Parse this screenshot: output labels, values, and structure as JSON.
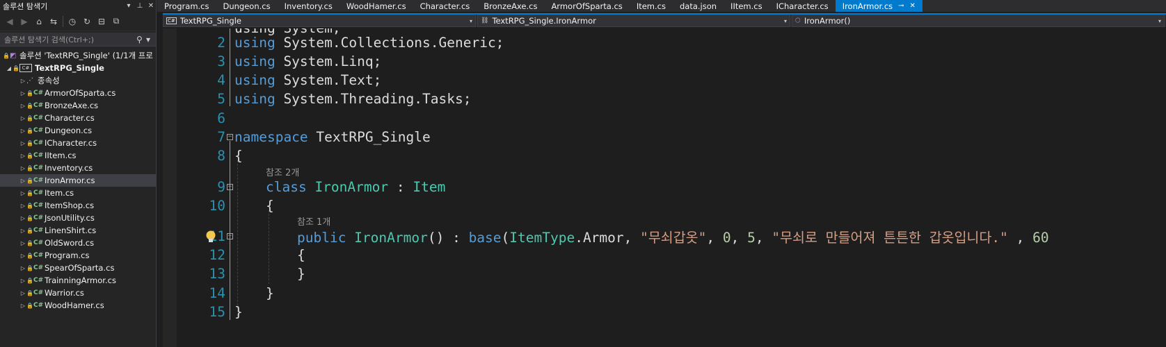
{
  "explorer": {
    "title": "솔루션 탐색기",
    "search_placeholder": "솔루션 탐색기 검색(Ctrl+;)",
    "solution_label": "솔루션 'TextRPG_Single' (1/1개 프로",
    "project_label": "TextRPG_Single",
    "dependencies_label": "종속성",
    "files": [
      "ArmorOfSparta.cs",
      "BronzeAxe.cs",
      "Character.cs",
      "Dungeon.cs",
      "ICharacter.cs",
      "IItem.cs",
      "Inventory.cs",
      "IronArmor.cs",
      "Item.cs",
      "ItemShop.cs",
      "JsonUtility.cs",
      "LinenShirt.cs",
      "OldSword.cs",
      "Program.cs",
      "SpearOfSparta.cs",
      "TrainningArmor.cs",
      "Warrior.cs",
      "WoodHamer.cs"
    ],
    "selected_file": "IronArmor.cs"
  },
  "tabs": [
    "Program.cs",
    "Dungeon.cs",
    "Inventory.cs",
    "WoodHamer.cs",
    "Character.cs",
    "BronzeAxe.cs",
    "ArmorOfSparta.cs",
    "Item.cs",
    "data.json",
    "IItem.cs",
    "ICharacter.cs",
    "IronArmor.cs"
  ],
  "active_tab": "IronArmor.cs",
  "navbar": {
    "project": "TextRPG_Single",
    "type": "TextRPG_Single.IronArmor",
    "member": "IronArmor()"
  },
  "editor": {
    "line_numbers": [
      "2",
      "3",
      "4",
      "5",
      "6",
      "7",
      "8",
      "9",
      "10",
      "11",
      "12",
      "13",
      "14",
      "15"
    ],
    "partial_line_top": "using System;",
    "code": {
      "l2_kw": "using",
      "l2_rest": " System.Collections.Generic;",
      "l3_kw": "using",
      "l3_rest": " System.Linq;",
      "l4_kw": "using",
      "l4_rest": " System.Text;",
      "l5_kw": "using",
      "l5_rest": " System.Threading.Tasks;",
      "l7_kw": "namespace",
      "l7_rest": " TextRPG_Single",
      "l8": "{",
      "hint_class": "참조 2개",
      "l9_kw": "class",
      "l9_name": " IronArmor",
      "l9_colon": " : ",
      "l9_base": "Item",
      "l10": "{",
      "hint_ctor": "참조 1개",
      "l11_kw": "public",
      "l11_name": " IronArmor",
      "l11_p1": "() : ",
      "l11_base": "base",
      "l11_p2": "(",
      "l11_type": "ItemType",
      "l11_p3": ".Armor, ",
      "l11_s1": "\"무쇠갑옷\"",
      "l11_c1": ", ",
      "l11_n1": "0",
      "l11_c2": ", ",
      "l11_n2": "5",
      "l11_c3": ", ",
      "l11_s2": "\"무쇠로 만들어져 튼튼한 갑옷입니다.\"",
      "l11_c4": " , ",
      "l11_n3": "60",
      "l12": "{",
      "l13": "}",
      "l14": "}",
      "l15": "}"
    }
  }
}
